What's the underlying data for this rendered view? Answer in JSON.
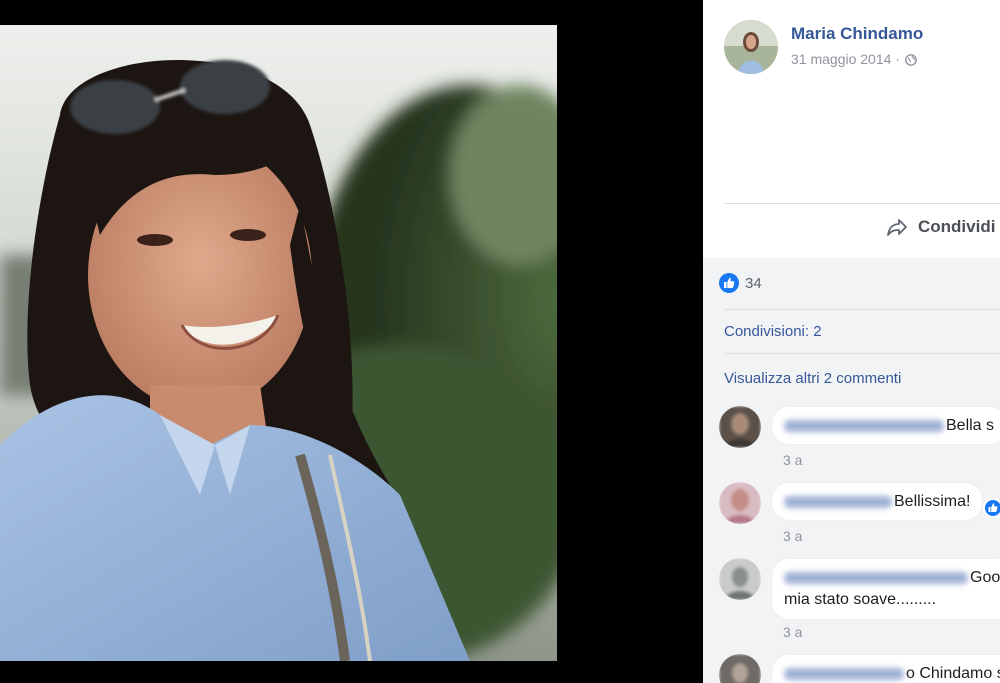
{
  "post": {
    "author": "Maria Chindamo",
    "date": "31 maggio 2014 ·",
    "share_label": "Condividi",
    "likes": "34",
    "shares": "Condivisioni: 2",
    "more_comments": "Visualizza altri 2 commenti"
  },
  "comments": [
    {
      "text": "Bella s",
      "time": "3 a"
    },
    {
      "text": "Bellissima!",
      "time": "3 a"
    },
    {
      "text": "Goo",
      "text2": "mia stato soave.........",
      "time": "3 a"
    },
    {
      "text": "o Chindamo s"
    }
  ],
  "icons": {
    "author_avatar": "avatar",
    "privacy": "globe-icon",
    "share": "share-arrow-icon",
    "reaction": "like-icon"
  },
  "colors": {
    "link": "#365899",
    "secondary": "#90949c",
    "like_blue": "#1877f2",
    "panel_bg": "#f2f3f5"
  }
}
